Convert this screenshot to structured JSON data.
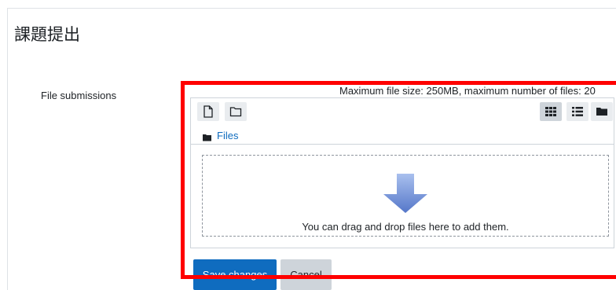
{
  "page": {
    "title": "課題提出"
  },
  "form": {
    "field_label": "File submissions",
    "limits_text": "Maximum file size: 250MB, maximum number of files: 20"
  },
  "filemanager": {
    "toolbar": {
      "left_buttons": [
        {
          "icon": "file-icon"
        },
        {
          "icon": "folder-icon"
        }
      ],
      "view_buttons": [
        {
          "icon": "grid-icon",
          "active": true
        },
        {
          "icon": "list-icon",
          "active": false
        },
        {
          "icon": "folder-tree-icon",
          "active": false
        }
      ]
    },
    "path": {
      "icon": "folder-icon",
      "label": "Files"
    },
    "dropzone": {
      "icon": "down-arrow-icon",
      "message": "You can drag and drop files here to add them."
    }
  },
  "actions": {
    "save_label": "Save changes",
    "cancel_label": "Cancel"
  },
  "colors": {
    "accent": "#0f6cbf",
    "highlight": "#ff0000",
    "secondary_button": "#ced4da",
    "toolbar_button": "#e9ecef"
  }
}
